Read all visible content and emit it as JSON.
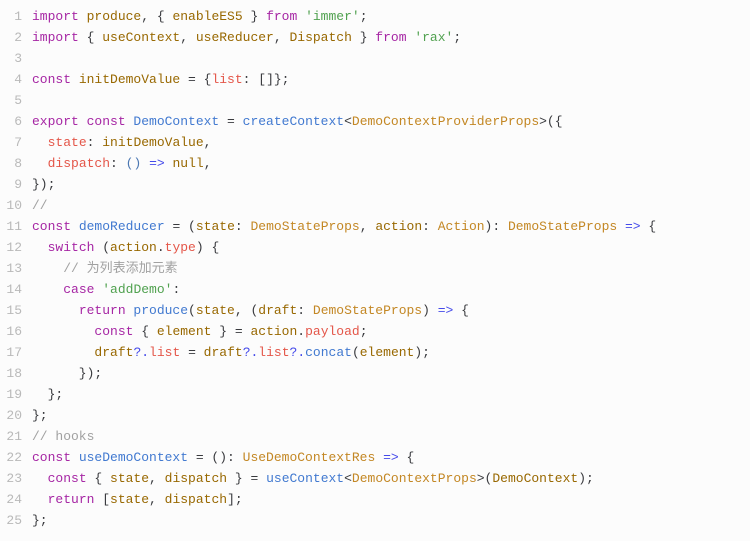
{
  "lines": [
    {
      "n": "1",
      "tokens": [
        [
          "keyword",
          "import "
        ],
        [
          "ident",
          "produce"
        ],
        [
          "punct",
          ", { "
        ],
        [
          "ident",
          "enableES5"
        ],
        [
          "punct",
          " } "
        ],
        [
          "keyword",
          "from "
        ],
        [
          "string",
          "'immer'"
        ],
        [
          "punct",
          ";"
        ]
      ]
    },
    {
      "n": "2",
      "tokens": [
        [
          "keyword",
          "import "
        ],
        [
          "punct",
          "{ "
        ],
        [
          "ident",
          "useContext"
        ],
        [
          "punct",
          ", "
        ],
        [
          "ident",
          "useReducer"
        ],
        [
          "punct",
          ", "
        ],
        [
          "ident",
          "Dispatch"
        ],
        [
          "punct",
          " } "
        ],
        [
          "keyword",
          "from "
        ],
        [
          "string",
          "'rax'"
        ],
        [
          "punct",
          ";"
        ]
      ]
    },
    {
      "n": "3",
      "tokens": []
    },
    {
      "n": "4",
      "tokens": [
        [
          "keyword",
          "const "
        ],
        [
          "ident",
          "initDemoValue"
        ],
        [
          "default",
          " = {"
        ],
        [
          "prop",
          "list"
        ],
        [
          "default",
          ": []};"
        ]
      ]
    },
    {
      "n": "5",
      "tokens": []
    },
    {
      "n": "6",
      "tokens": [
        [
          "keyword",
          "export const "
        ],
        [
          "func",
          "DemoContext"
        ],
        [
          "default",
          " = "
        ],
        [
          "func",
          "createContext"
        ],
        [
          "default",
          "<"
        ],
        [
          "type",
          "DemoContextProviderProps"
        ],
        [
          "default",
          ">({"
        ]
      ]
    },
    {
      "n": "7",
      "tokens": [
        [
          "default",
          "  "
        ],
        [
          "prop",
          "state"
        ],
        [
          "default",
          ": "
        ],
        [
          "ident",
          "initDemoValue"
        ],
        [
          "default",
          ","
        ]
      ]
    },
    {
      "n": "8",
      "tokens": [
        [
          "default",
          "  "
        ],
        [
          "prop",
          "dispatch"
        ],
        [
          "default",
          ": "
        ],
        [
          "paren",
          "()"
        ],
        [
          "default",
          " "
        ],
        [
          "op",
          "=>"
        ],
        [
          "default",
          " "
        ],
        [
          "literal",
          "null"
        ],
        [
          "default",
          ","
        ]
      ]
    },
    {
      "n": "9",
      "tokens": [
        [
          "default",
          "});"
        ]
      ]
    },
    {
      "n": "10",
      "tokens": [
        [
          "comment",
          "//"
        ]
      ]
    },
    {
      "n": "11",
      "tokens": [
        [
          "keyword",
          "const "
        ],
        [
          "func",
          "demoReducer"
        ],
        [
          "default",
          " = ("
        ],
        [
          "ident",
          "state"
        ],
        [
          "default",
          ": "
        ],
        [
          "type",
          "DemoStateProps"
        ],
        [
          "default",
          ", "
        ],
        [
          "ident",
          "action"
        ],
        [
          "default",
          ": "
        ],
        [
          "type",
          "Action"
        ],
        [
          "default",
          "): "
        ],
        [
          "type",
          "DemoStateProps"
        ],
        [
          "default",
          " "
        ],
        [
          "op",
          "=>"
        ],
        [
          "default",
          " {"
        ]
      ]
    },
    {
      "n": "12",
      "tokens": [
        [
          "default",
          "  "
        ],
        [
          "keyword",
          "switch"
        ],
        [
          "default",
          " ("
        ],
        [
          "ident",
          "action"
        ],
        [
          "default",
          "."
        ],
        [
          "prop",
          "type"
        ],
        [
          "default",
          ") {"
        ]
      ]
    },
    {
      "n": "13",
      "tokens": [
        [
          "default",
          "    "
        ],
        [
          "comment",
          "// 为列表添加元素"
        ]
      ]
    },
    {
      "n": "14",
      "tokens": [
        [
          "default",
          "    "
        ],
        [
          "keyword",
          "case "
        ],
        [
          "string",
          "'addDemo'"
        ],
        [
          "default",
          ":"
        ]
      ]
    },
    {
      "n": "15",
      "tokens": [
        [
          "default",
          "      "
        ],
        [
          "keyword",
          "return "
        ],
        [
          "func",
          "produce"
        ],
        [
          "default",
          "("
        ],
        [
          "ident",
          "state"
        ],
        [
          "default",
          ", ("
        ],
        [
          "ident",
          "draft"
        ],
        [
          "default",
          ": "
        ],
        [
          "type",
          "DemoStateProps"
        ],
        [
          "default",
          ") "
        ],
        [
          "op",
          "=>"
        ],
        [
          "default",
          " {"
        ]
      ]
    },
    {
      "n": "16",
      "tokens": [
        [
          "default",
          "        "
        ],
        [
          "keyword",
          "const "
        ],
        [
          "default",
          "{ "
        ],
        [
          "ident",
          "element"
        ],
        [
          "default",
          " } = "
        ],
        [
          "ident",
          "action"
        ],
        [
          "default",
          "."
        ],
        [
          "prop",
          "payload"
        ],
        [
          "default",
          ";"
        ]
      ]
    },
    {
      "n": "17",
      "tokens": [
        [
          "default",
          "        "
        ],
        [
          "ident",
          "draft"
        ],
        [
          "op",
          "?."
        ],
        [
          "prop",
          "list"
        ],
        [
          "default",
          " = "
        ],
        [
          "ident",
          "draft"
        ],
        [
          "op",
          "?."
        ],
        [
          "prop",
          "list"
        ],
        [
          "op",
          "?."
        ],
        [
          "func",
          "concat"
        ],
        [
          "default",
          "("
        ],
        [
          "ident",
          "element"
        ],
        [
          "default",
          ");"
        ]
      ]
    },
    {
      "n": "18",
      "tokens": [
        [
          "default",
          "      });"
        ]
      ]
    },
    {
      "n": "19",
      "tokens": [
        [
          "default",
          "  };"
        ]
      ]
    },
    {
      "n": "20",
      "tokens": [
        [
          "default",
          "};"
        ]
      ]
    },
    {
      "n": "21",
      "tokens": [
        [
          "comment",
          "// hooks"
        ]
      ]
    },
    {
      "n": "22",
      "tokens": [
        [
          "keyword",
          "const "
        ],
        [
          "func",
          "useDemoContext"
        ],
        [
          "default",
          " = (): "
        ],
        [
          "type",
          "UseDemoContextRes"
        ],
        [
          "default",
          " "
        ],
        [
          "op",
          "=>"
        ],
        [
          "default",
          " {"
        ]
      ]
    },
    {
      "n": "23",
      "tokens": [
        [
          "default",
          "  "
        ],
        [
          "keyword",
          "const "
        ],
        [
          "default",
          "{ "
        ],
        [
          "ident",
          "state"
        ],
        [
          "default",
          ", "
        ],
        [
          "ident",
          "dispatch"
        ],
        [
          "default",
          " } = "
        ],
        [
          "func",
          "useContext"
        ],
        [
          "default",
          "<"
        ],
        [
          "type",
          "DemoContextProps"
        ],
        [
          "default",
          ">("
        ],
        [
          "ident",
          "DemoContext"
        ],
        [
          "default",
          ");"
        ]
      ]
    },
    {
      "n": "24",
      "tokens": [
        [
          "default",
          "  "
        ],
        [
          "keyword",
          "return"
        ],
        [
          "default",
          " ["
        ],
        [
          "ident",
          "state"
        ],
        [
          "default",
          ", "
        ],
        [
          "ident",
          "dispatch"
        ],
        [
          "default",
          "];"
        ]
      ]
    },
    {
      "n": "25",
      "tokens": [
        [
          "default",
          "};"
        ]
      ]
    }
  ]
}
